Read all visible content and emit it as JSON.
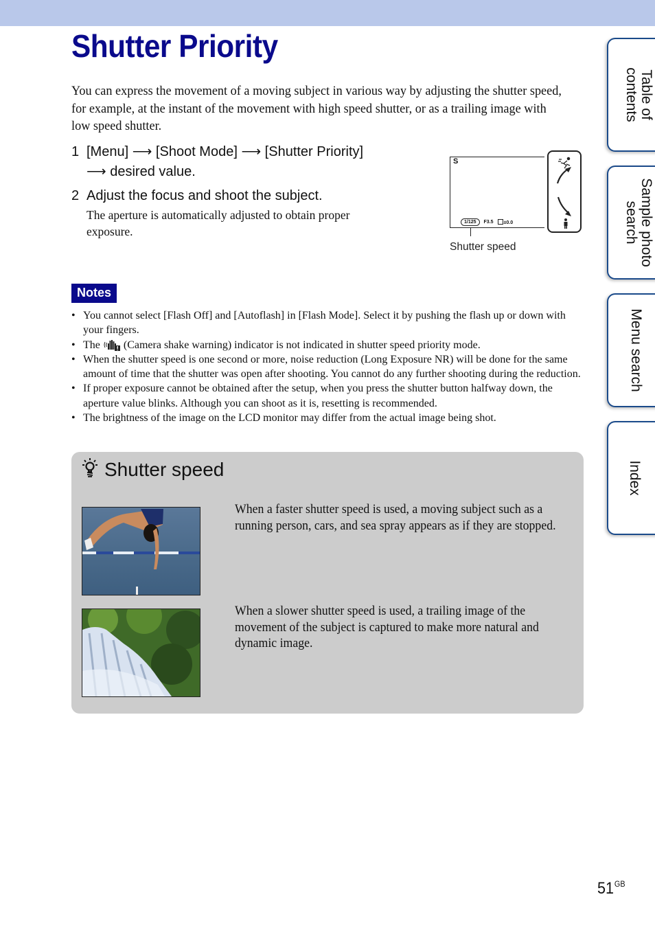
{
  "page": {
    "title": "Shutter Priority",
    "intro": "You can express the movement of a moving subject in various way by adjusting the shutter speed, for example, at the instant of the movement with high speed shutter, or as a trailing image with low speed shutter.",
    "page_number": "51",
    "page_suffix": "GB"
  },
  "steps": [
    {
      "number": "1",
      "line1": "[Menu] ⟶ [Shoot Mode] ⟶ [Shutter Priority]",
      "line2": "⟶ desired value."
    },
    {
      "number": "2",
      "text": "Adjust the focus and shoot the subject.",
      "detail": "The aperture is automatically adjusted to obtain proper exposure."
    }
  ],
  "illustration": {
    "mode_letter": "S",
    "shutter_value": "1/125",
    "aperture_value": "F3.5",
    "exposure_value": "±0.0",
    "caption": "Shutter speed",
    "dial_top_icon": "running-person-icon",
    "dial_bottom_icon": "standing-person-icon"
  },
  "notes": {
    "label": "Notes",
    "items": [
      "You cannot select [Flash Off] and [Autoflash] in [Flash Mode]. Select it by pushing the flash up or down with your fingers.",
      "(Camera shake warning) indicator is not indicated in shutter speed priority mode.",
      "When the shutter speed is one second or more, noise reduction (Long Exposure NR) will be done for the same amount of time that the shutter was open after shooting. You cannot do any further shooting during the reduction.",
      "If proper exposure cannot be obtained after the setup, when you press the shutter button halfway down, the aperture value blinks. Although you can shoot as it is, resetting is recommended.",
      "The brightness of the image on the LCD monitor may differ from the actual image being shot."
    ],
    "item2_prefix": "The"
  },
  "tip": {
    "title": "Shutter speed",
    "icon": "lightbulb-hint-icon",
    "entries": [
      {
        "image": "high-jump-athlete-photo",
        "text": "When a faster shutter speed is used, a moving subject such as a running person, cars, and sea spray appears as if they are stopped."
      },
      {
        "image": "waterfall-photo",
        "text": "When a slower shutter speed is used, a trailing image of the movement of the subject is captured to make more natural and dynamic image."
      }
    ]
  },
  "side_tabs": [
    {
      "label": "Table of\ncontents"
    },
    {
      "label": "Sample photo\nsearch"
    },
    {
      "label": "Menu search"
    },
    {
      "label": "Index"
    }
  ],
  "colors": {
    "title_blue": "#0a0a8c",
    "top_band": "#b9c8ea",
    "tab_border": "#1a4a8a",
    "tip_background": "#cccccc"
  }
}
